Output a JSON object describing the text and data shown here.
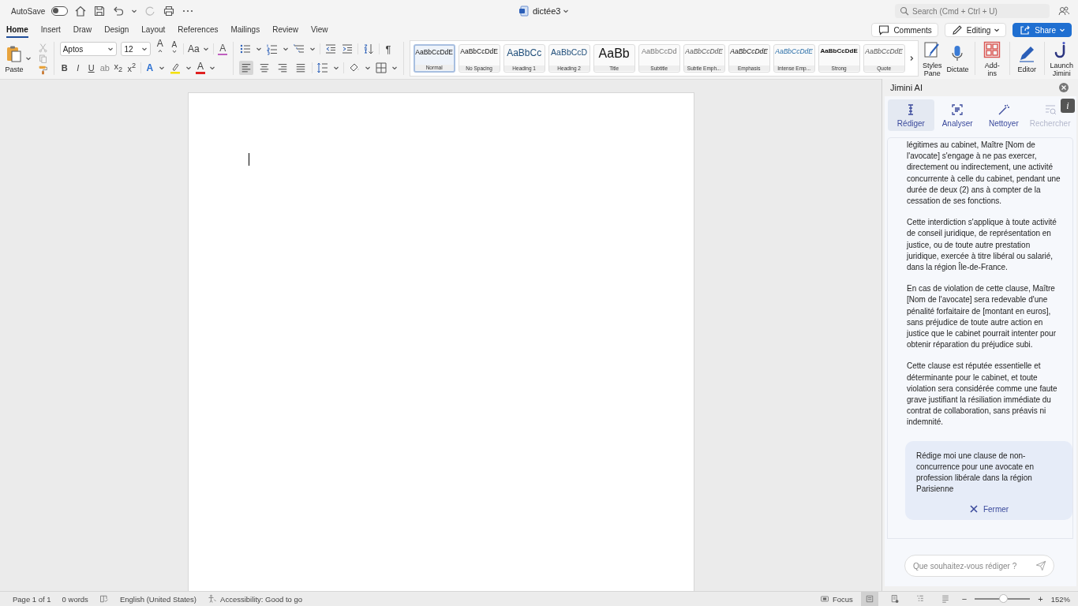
{
  "title_bar": {
    "autosave_label": "AutoSave",
    "autosave_on": false,
    "document_title": "dictée3",
    "search_placeholder": "Search (Cmd + Ctrl + U)"
  },
  "tabs": [
    {
      "label": "Home",
      "selected": true
    },
    {
      "label": "Insert",
      "selected": false
    },
    {
      "label": "Draw",
      "selected": false
    },
    {
      "label": "Design",
      "selected": false
    },
    {
      "label": "Layout",
      "selected": false
    },
    {
      "label": "References",
      "selected": false
    },
    {
      "label": "Mailings",
      "selected": false
    },
    {
      "label": "Review",
      "selected": false
    },
    {
      "label": "View",
      "selected": false
    }
  ],
  "actions": {
    "comments": "Comments",
    "editing": "Editing",
    "share": "Share"
  },
  "ribbon": {
    "paste": "Paste",
    "font": "Aptos",
    "size": "12",
    "grow_font": "A",
    "shrink_font": "A",
    "change_case": "Aa",
    "clear_format": "A",
    "format_buttons": [
      "B",
      "I",
      "U",
      "ab",
      "x$_{2}$",
      "x$^{2}$"
    ],
    "text_effects": "A",
    "font_color": "A",
    "pilcrow": "¶",
    "align_buttons": [
      {
        "kind": "left",
        "selected": true
      },
      {
        "kind": "center",
        "selected": false
      },
      {
        "kind": "right",
        "selected": false
      },
      {
        "kind": "justify",
        "selected": false
      }
    ],
    "styles": [
      {
        "sample": "AaBbCcDdE",
        "label": "Normal",
        "kind": "normal",
        "selected": true
      },
      {
        "sample": "AaBbCcDdE",
        "label": "No Spacing",
        "kind": "normal",
        "selected": false
      },
      {
        "sample": "AaBbCc",
        "label": "Heading 1",
        "kind": "heading1",
        "selected": false
      },
      {
        "sample": "AaBbCcD",
        "label": "Heading 2",
        "kind": "heading2",
        "selected": false
      },
      {
        "sample": "AaBb",
        "label": "Title",
        "kind": "title",
        "selected": false
      },
      {
        "sample": "AaBbCcDd",
        "label": "Subtitle",
        "kind": "subtitle",
        "selected": false
      },
      {
        "sample": "AaBbCcDdE",
        "label": "Subtle Emph...",
        "kind": "subtle",
        "selected": false
      },
      {
        "sample": "AaBbCcDdE",
        "label": "Emphasis",
        "kind": "emphasis",
        "selected": false
      },
      {
        "sample": "AaBbCcDdE",
        "label": "Intense Emp...",
        "kind": "intense",
        "selected": false
      },
      {
        "sample": "AaBbCcDdE",
        "label": "Strong",
        "kind": "strong",
        "selected": false
      },
      {
        "sample": "AaBbCcDdE",
        "label": "Quote",
        "kind": "quote",
        "selected": false
      }
    ],
    "big_buttons": [
      {
        "label": "Styles Pane",
        "kind": "styles"
      },
      {
        "label": "Dictate",
        "kind": "dictate"
      },
      {
        "label": "Add-ins",
        "kind": "addins"
      },
      {
        "label": "Editor",
        "kind": "editor"
      },
      {
        "label": "Launch Jimini",
        "kind": "jimini"
      }
    ]
  },
  "panel": {
    "title": "Jimini AI",
    "tabs": [
      {
        "label": "Rédiger",
        "kind": "write",
        "selected": true,
        "disabled": false
      },
      {
        "label": "Analyser",
        "kind": "analyse",
        "selected": false,
        "disabled": false
      },
      {
        "label": "Nettoyer",
        "kind": "clean",
        "selected": false,
        "disabled": false
      },
      {
        "label": "Rechercher",
        "kind": "search",
        "selected": false,
        "disabled": true
      }
    ],
    "info": "i",
    "paragraphs": [
      "légitimes au cabinet, Maître [Nom de l'avocate] s'engage à ne pas exercer, directement ou indirectement, une activité concurrente à celle du cabinet, pendant une durée de deux (2) ans à compter de la cessation de ses fonctions.",
      "Cette interdiction s'applique à toute activité de conseil juridique, de représentation en justice, ou de toute autre prestation juridique, exercée à titre libéral ou salarié, dans la région Île-de-France.",
      "En cas de violation de cette clause, Maître [Nom de l'avocate] sera redevable d'une pénalité forfaitaire de [montant en euros], sans préjudice de toute autre action en justice que le cabinet pourrait intenter pour obtenir réparation du préjudice subi.",
      "Cette clause est réputée essentielle et déterminante pour le cabinet, et toute violation sera considérée comme une faute grave justifiant la résiliation immédiate du contrat de collaboration, sans préavis ni indemnité."
    ],
    "prompt": "Rédige moi une clause de non-concurrence pour une avocate en profession libérale dans la région Parisienne",
    "close_label": "Fermer",
    "input_placeholder": "Que souhaitez-vous rédiger ?"
  },
  "status_bar": {
    "page": "Page 1 of 1",
    "words": "0 words",
    "language": "English (United States)",
    "accessibility": "Accessibility: Good to go",
    "focus": "Focus",
    "views": [
      {
        "kind": "print",
        "selected": true
      },
      {
        "kind": "web",
        "selected": false
      },
      {
        "kind": "outline",
        "selected": false
      },
      {
        "kind": "draft",
        "selected": false
      }
    ],
    "zoom": {
      "level": 0.53,
      "reading": "152%",
      "zoom_out": "−",
      "zoom_in": "+"
    }
  }
}
